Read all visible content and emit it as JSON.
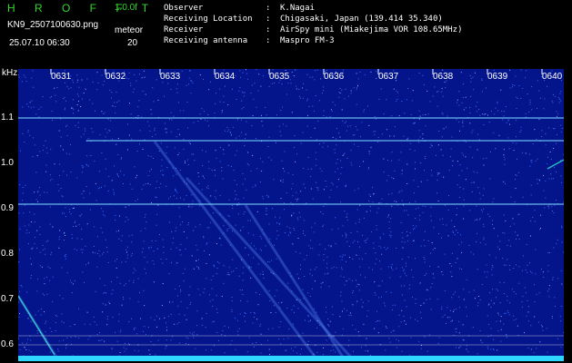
{
  "header": {
    "brand": "H R O F F T",
    "version": "1.0.0f",
    "filename": "KN9_2507100630.png",
    "meteor_label": "meteor",
    "meteor_count": "20",
    "timestamp": "25.07.10 06:30",
    "info_rows": [
      {
        "key": "Observer",
        "value": "K.Nagai"
      },
      {
        "key": "Receiving Location",
        "value": "Chigasaki, Japan (139.414 35.340)"
      },
      {
        "key": "Receiver",
        "value": "AirSpy mini (Miakejima VOR 108.65MHz)"
      },
      {
        "key": "Receiving antenna",
        "value": "Maspro FM-3"
      }
    ]
  },
  "axis": {
    "unit": "kHz",
    "y_labels": [
      "1.1",
      "1.0",
      "0.9",
      "0.8",
      "0.7",
      "0.6"
    ],
    "x_labels": [
      "0631",
      "0632",
      "0633",
      "0634",
      "0635",
      "0636",
      "0637",
      "0638",
      "0639",
      "0640"
    ]
  },
  "colors": {
    "background": "#04148a",
    "line": "#7ad6ff",
    "noise": "#3a70ff",
    "brand": "#35d62e"
  }
}
